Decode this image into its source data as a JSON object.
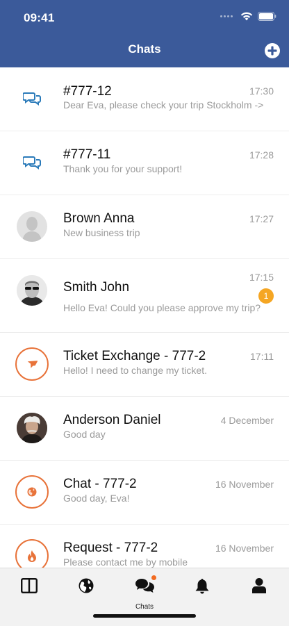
{
  "status_bar": {
    "time": "09:41"
  },
  "header": {
    "title": "Chats"
  },
  "chats": [
    {
      "name": "#777-12",
      "message": "Dear Eva, please check your trip Stockholm ->",
      "time": "17:30",
      "avatar": "chat-bubbles-icon"
    },
    {
      "name": "#777-11",
      "message": "Thank you for your support!",
      "time": "17:28",
      "avatar": "chat-bubbles-icon"
    },
    {
      "name": "Brown Anna",
      "message": "New business trip",
      "time": "17:27",
      "avatar": "person-placeholder"
    },
    {
      "name": "Smith John",
      "message": "Hello Eva! Could you please approve my trip?",
      "time": "17:15",
      "badge": "1",
      "avatar": "photo"
    },
    {
      "name": "Ticket Exchange - 777-2",
      "message": "Hello! I need to change my ticket.",
      "time": "17:11",
      "avatar": "airplane-icon"
    },
    {
      "name": "Anderson Daniel",
      "message": "Good day",
      "time": "4 December",
      "avatar": "photo"
    },
    {
      "name": "Chat - 777-2",
      "message": "Good day, Eva!",
      "time": "16 November",
      "avatar": "globe-icon"
    },
    {
      "name": "Request - 777-2",
      "message": "Please contact me by mobile",
      "time": "16 November",
      "avatar": "fire-icon"
    }
  ],
  "tabbar": {
    "tabs": [
      "dashboard-icon",
      "globe-icon",
      "chats-icon",
      "bell-icon",
      "profile-icon"
    ],
    "active_label": "Chats"
  },
  "colors": {
    "header": "#3b5a9a",
    "accent": "#e8733a",
    "badge": "#f5a623",
    "chat_icon": "#2a7ab9"
  }
}
